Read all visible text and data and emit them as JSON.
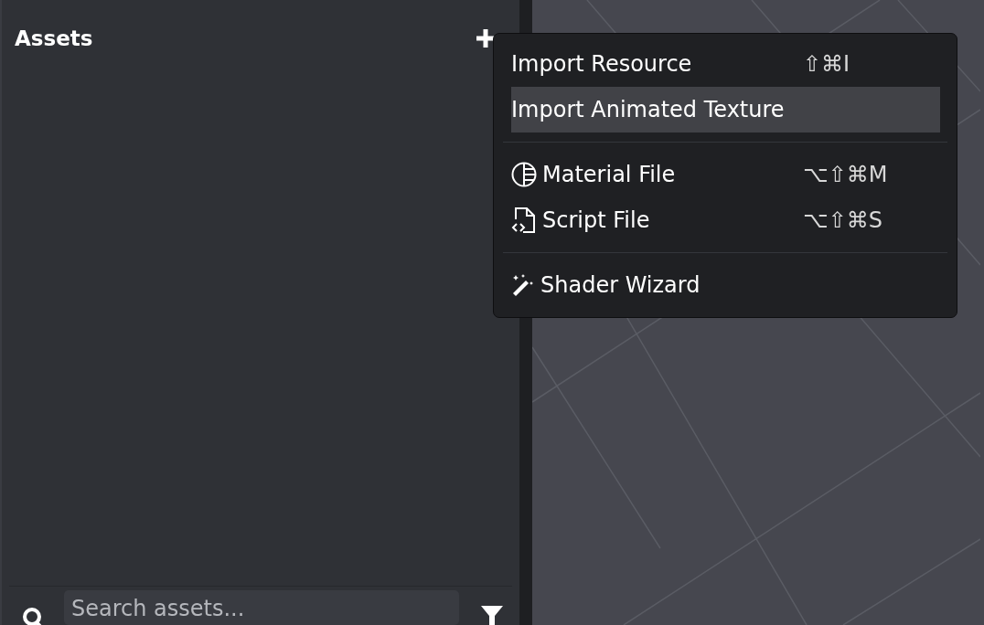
{
  "panel": {
    "title": "Assets",
    "search": {
      "placeholder": "Search assets..."
    }
  },
  "menu": {
    "groups": [
      {
        "items": [
          {
            "kind": "plain",
            "label": "Import Resource",
            "shortcut": "⇧⌘I",
            "selected": false
          },
          {
            "kind": "plain",
            "label": "Import Animated Texture",
            "selected": true
          }
        ]
      },
      {
        "items": [
          {
            "kind": "material",
            "label": "Material File",
            "shortcut": "⌥⇧⌘M",
            "selected": false
          },
          {
            "kind": "script",
            "label": "Script File",
            "shortcut": "⌥⇧⌘S",
            "selected": false
          }
        ]
      },
      {
        "items": [
          {
            "kind": "wizard",
            "label": "Shader Wizard",
            "selected": false
          }
        ]
      }
    ]
  }
}
